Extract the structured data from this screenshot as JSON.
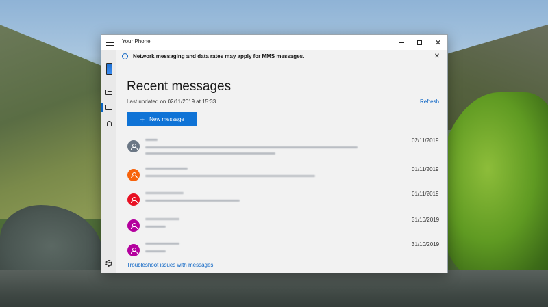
{
  "window": {
    "title": "Your Phone",
    "controls": {
      "minimize_icon": "minimize-icon",
      "maximize_icon": "maximize-icon",
      "close_icon": "close-icon"
    }
  },
  "banner": {
    "text": "Network messaging and data rates may apply for MMS messages.",
    "close_glyph": "✕"
  },
  "rail": {
    "items": [
      {
        "name": "phone",
        "icon": "phone-icon",
        "selected": false
      },
      {
        "name": "photos",
        "icon": "photos-icon",
        "selected": false
      },
      {
        "name": "messages",
        "icon": "message-icon",
        "selected": true
      },
      {
        "name": "notifications",
        "icon": "bell-icon",
        "selected": false
      },
      {
        "name": "settings",
        "icon": "gear-icon",
        "selected": false
      }
    ]
  },
  "main": {
    "title": "Recent messages",
    "last_updated": "Last updated on 02/11/2019 at 15:33",
    "refresh_label": "Refresh",
    "new_message_label": "New message",
    "new_message_plus": "+",
    "troubleshoot_label": "Troubleshoot issues with messages"
  },
  "messages": [
    {
      "date": "02/11/2019",
      "avatar_color": "#6b7785",
      "content_obscured": true
    },
    {
      "date": "01/11/2019",
      "avatar_color": "#f7630c",
      "content_obscured": true
    },
    {
      "date": "01/11/2019",
      "avatar_color": "#e81123",
      "content_obscured": true
    },
    {
      "date": "31/10/2019",
      "avatar_color": "#b4009e",
      "content_obscured": true
    },
    {
      "date": "31/10/2019",
      "avatar_color": "#b4009e",
      "content_obscured": true
    }
  ],
  "colors": {
    "accent": "#0f73d6",
    "link": "#0a63c4",
    "window_bg": "#f2f2f2"
  }
}
